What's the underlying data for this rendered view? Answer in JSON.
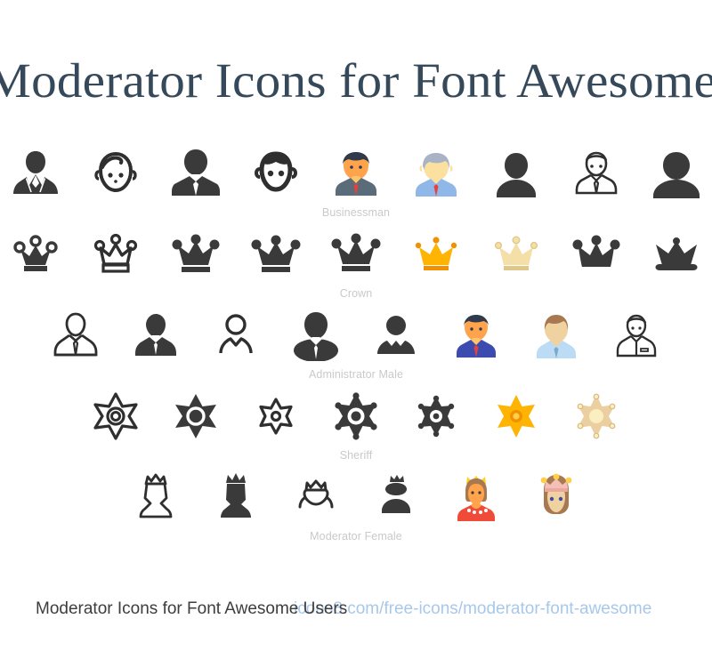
{
  "page": {
    "title": "Moderator Icons for Font Awesome Users",
    "background_color": "#ffffff",
    "title_color": "#36495a"
  },
  "footer": {
    "caption": "Moderator Icons for Font Awesome Users",
    "url": "icons8.com/free-icons/moderator-font-awesome",
    "caption_color": "#3d3d3d",
    "url_color": "#a8c8ea"
  },
  "palette": {
    "dark": "#3a3a3a",
    "outline": "#2f2f2f",
    "gold": "#ffb302",
    "gold_dark": "#f19100",
    "tan": "#f5dfa8",
    "tan_dark": "#e0c88a",
    "skin_orange": "#ffa34d",
    "skin_pale": "#fbe0a0",
    "skin_tan": "#f0d2a0",
    "suit_navy": "#3b4bb0",
    "suit_slate": "#5a6b7a",
    "shirt_blue": "#8fb8e8",
    "shirt_lightblue": "#bcdcf5",
    "tie_red": "#e8403a",
    "hair_brown": "#a87850",
    "hair_dark": "#2f3a4a",
    "hair_gray": "#a8b4c6",
    "dress_red": "#f04b38",
    "crown_pink": "#f3c0b8"
  },
  "rows": [
    {
      "label": "Businessman",
      "icons": [
        {
          "name": "businessman-suit-outline-filled",
          "style": "filled"
        },
        {
          "name": "businessman-face-outline",
          "style": "outline"
        },
        {
          "name": "businessman-tie-filled",
          "style": "filled"
        },
        {
          "name": "businessman-head-outline",
          "style": "outline"
        },
        {
          "name": "businessman-color-orange",
          "style": "color"
        },
        {
          "name": "businessman-color-gray-hair",
          "style": "color"
        },
        {
          "name": "businessman-silhouette-filled",
          "style": "filled"
        },
        {
          "name": "businessman-line-art",
          "style": "outline"
        },
        {
          "name": "businessman-bust-filled",
          "style": "filled"
        }
      ]
    },
    {
      "label": "Crown",
      "icons": [
        {
          "name": "crown-balls-small-filled",
          "style": "filled"
        },
        {
          "name": "crown-outline",
          "style": "outline"
        },
        {
          "name": "crown-filled-base",
          "style": "filled"
        },
        {
          "name": "crown-filled-wide",
          "style": "filled"
        },
        {
          "name": "crown-filled-tall",
          "style": "filled"
        },
        {
          "name": "crown-color-gold",
          "style": "color"
        },
        {
          "name": "crown-color-tan",
          "style": "color"
        },
        {
          "name": "crown-solid-rounded",
          "style": "filled"
        },
        {
          "name": "crown-solid-flat",
          "style": "filled"
        }
      ]
    },
    {
      "label": "Administrator Male",
      "icons": [
        {
          "name": "administrator-male-outline",
          "style": "outline"
        },
        {
          "name": "administrator-male-filled",
          "style": "filled"
        },
        {
          "name": "administrator-male-thin-outline",
          "style": "outline"
        },
        {
          "name": "administrator-male-oval-filled",
          "style": "filled"
        },
        {
          "name": "administrator-male-simple-filled",
          "style": "filled"
        },
        {
          "name": "administrator-male-color-navy",
          "style": "color"
        },
        {
          "name": "administrator-male-color-brown-hair",
          "style": "color"
        },
        {
          "name": "administrator-male-line-art",
          "style": "outline"
        }
      ]
    },
    {
      "label": "Sheriff",
      "icons": [
        {
          "name": "sheriff-badge-outline",
          "style": "outline"
        },
        {
          "name": "sheriff-badge-filled-ring",
          "style": "filled"
        },
        {
          "name": "sheriff-badge-small-outline",
          "style": "outline"
        },
        {
          "name": "sheriff-badge-filled-large",
          "style": "filled"
        },
        {
          "name": "sheriff-badge-filled-dots",
          "style": "filled"
        },
        {
          "name": "sheriff-badge-color-gold",
          "style": "color"
        },
        {
          "name": "sheriff-badge-color-tan",
          "style": "color"
        }
      ]
    },
    {
      "label": "Moderator Female",
      "icons": [
        {
          "name": "moderator-female-outline",
          "style": "outline"
        },
        {
          "name": "moderator-female-filled",
          "style": "filled"
        },
        {
          "name": "moderator-female-face-outline",
          "style": "outline"
        },
        {
          "name": "moderator-female-bust-filled",
          "style": "filled"
        },
        {
          "name": "moderator-female-color-queen",
          "style": "color"
        },
        {
          "name": "moderator-female-color-princess",
          "style": "color"
        }
      ]
    }
  ]
}
